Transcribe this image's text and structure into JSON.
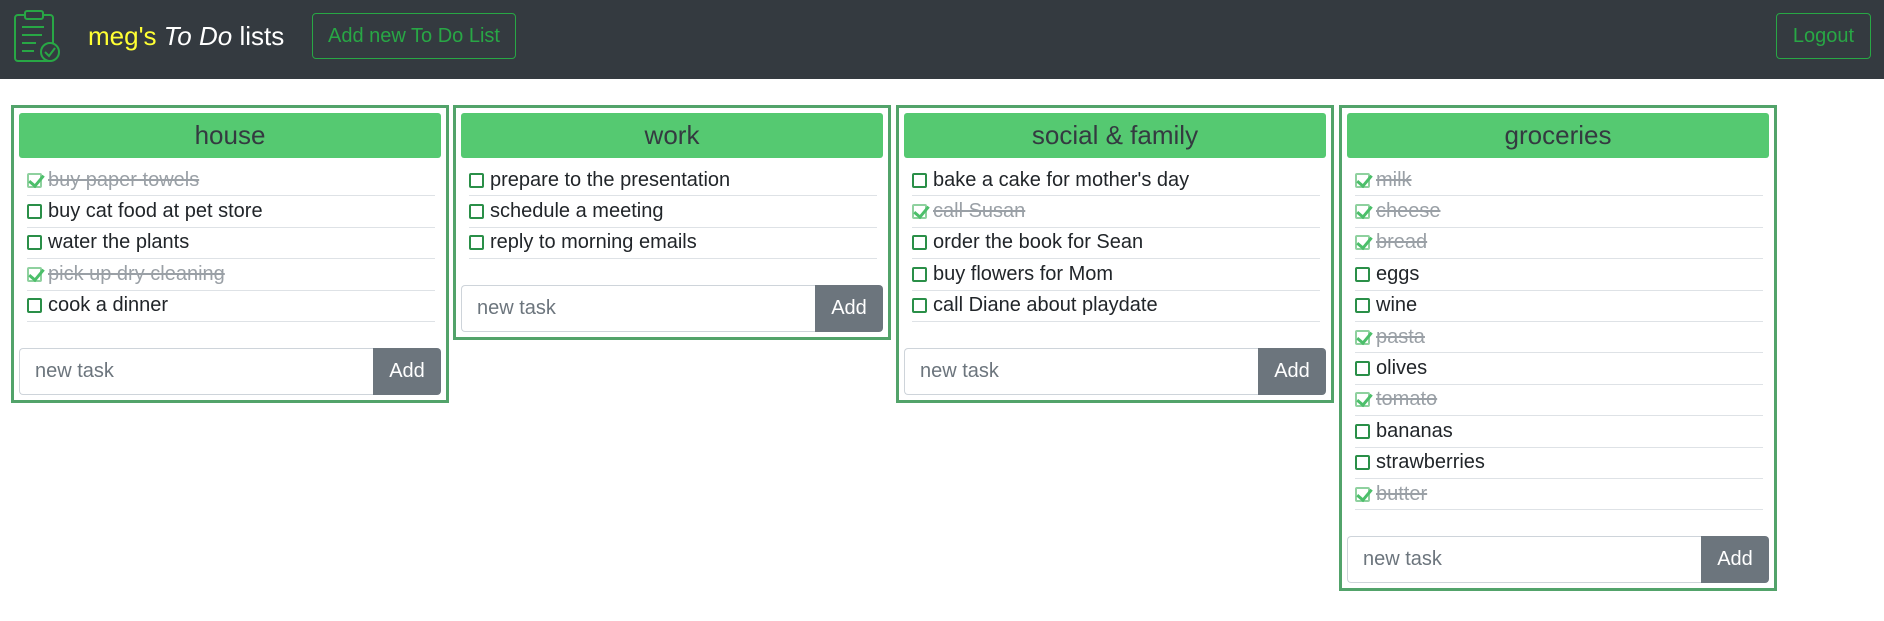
{
  "header": {
    "logo_icon": "clipboard-check-icon",
    "brand_owner": "meg's",
    "brand_italic": "To Do",
    "brand_suffix": "lists",
    "add_list_label": "Add new To Do List",
    "logout_label": "Logout"
  },
  "colors": {
    "navbar_bg": "#343a40",
    "accent_green": "#28a745",
    "card_header": "#55c971",
    "owner_yellow": "#ffff33",
    "add_button": "#6c757d"
  },
  "lists": [
    {
      "title": "house",
      "tasks": [
        {
          "text": "buy paper towels",
          "done": true
        },
        {
          "text": "buy cat food at pet store",
          "done": false
        },
        {
          "text": "water the plants",
          "done": false
        },
        {
          "text": "pick up dry cleaning",
          "done": true
        },
        {
          "text": "cook a dinner",
          "done": false
        }
      ],
      "input_placeholder": "new task",
      "add_label": "Add"
    },
    {
      "title": "work",
      "tasks": [
        {
          "text": "prepare to the presentation",
          "done": false
        },
        {
          "text": "schedule a meeting",
          "done": false
        },
        {
          "text": "reply to morning emails",
          "done": false
        }
      ],
      "input_placeholder": "new task",
      "add_label": "Add"
    },
    {
      "title": "social & family",
      "tasks": [
        {
          "text": "bake a cake for mother's day",
          "done": false
        },
        {
          "text": "call Susan",
          "done": true
        },
        {
          "text": "order the book for Sean",
          "done": false
        },
        {
          "text": "buy flowers for Mom",
          "done": false
        },
        {
          "text": "call Diane about playdate",
          "done": false
        }
      ],
      "input_placeholder": "new task",
      "add_label": "Add"
    },
    {
      "title": "groceries",
      "tasks": [
        {
          "text": "milk",
          "done": true
        },
        {
          "text": "cheese",
          "done": true
        },
        {
          "text": "bread",
          "done": true
        },
        {
          "text": "eggs",
          "done": false
        },
        {
          "text": "wine",
          "done": false
        },
        {
          "text": "pasta",
          "done": true
        },
        {
          "text": "olives",
          "done": false
        },
        {
          "text": "tomato",
          "done": true
        },
        {
          "text": "bananas",
          "done": false
        },
        {
          "text": "strawberries",
          "done": false
        },
        {
          "text": "butter",
          "done": true
        }
      ],
      "input_placeholder": "new task",
      "add_label": "Add"
    }
  ]
}
